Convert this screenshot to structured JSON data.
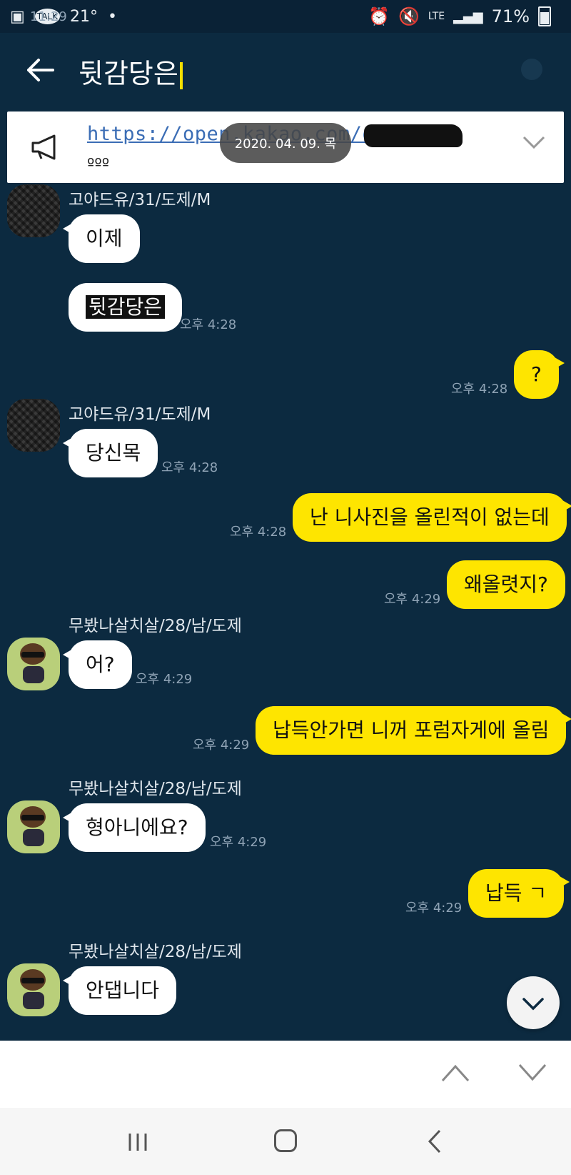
{
  "status_bar": {
    "time": "11:29",
    "talk_label": "TALK",
    "temperature": "21°",
    "network": "LTE",
    "battery": "71%"
  },
  "header": {
    "search_query": "뒷감당은"
  },
  "notice": {
    "link_text": "https://open.kakao.com/o/",
    "more": "ººº",
    "date_pill": "2020. 04. 09. 목"
  },
  "messages": [
    {
      "side": "left",
      "sender": "고야드유/31/도제/M",
      "bubbles": [
        "이제",
        "뒷감당은"
      ],
      "time": "오후 4:28",
      "avatar": "goyard"
    },
    {
      "side": "right",
      "bubbles": [
        "?"
      ],
      "time": "오후 4:28"
    },
    {
      "side": "left",
      "sender": "고야드유/31/도제/M",
      "bubbles": [
        "당신목"
      ],
      "time": "오후 4:28",
      "avatar": "goyard"
    },
    {
      "side": "right",
      "bubbles": [
        "난 니사진을 올린적이 없는데",
        "왜올렷지?"
      ],
      "times": [
        "오후 4:28",
        "오후 4:29"
      ]
    },
    {
      "side": "left",
      "sender": "무봤나살치살/28/남/도제",
      "bubbles": [
        "어?"
      ],
      "time": "오후 4:29",
      "avatar": "char"
    },
    {
      "side": "right",
      "bubbles": [
        "납득안가면 니꺼 포럼자게에 올림"
      ],
      "time": "오후 4:29"
    },
    {
      "side": "left",
      "sender": "무봤나살치살/28/남/도제",
      "bubbles": [
        "형아니에요?"
      ],
      "time": "오후 4:29",
      "avatar": "char"
    },
    {
      "side": "right",
      "bubbles": [
        "납득 ㄱ"
      ],
      "time": "오후 4:29"
    },
    {
      "side": "left",
      "sender": "무봤나살치살/28/남/도제",
      "bubbles": [
        "안댑니다"
      ],
      "avatar": "char"
    }
  ],
  "colors": {
    "background": "#0c2a40",
    "my_bubble": "#fee500",
    "other_bubble": "#ffffff",
    "caret": "#f6df00"
  }
}
